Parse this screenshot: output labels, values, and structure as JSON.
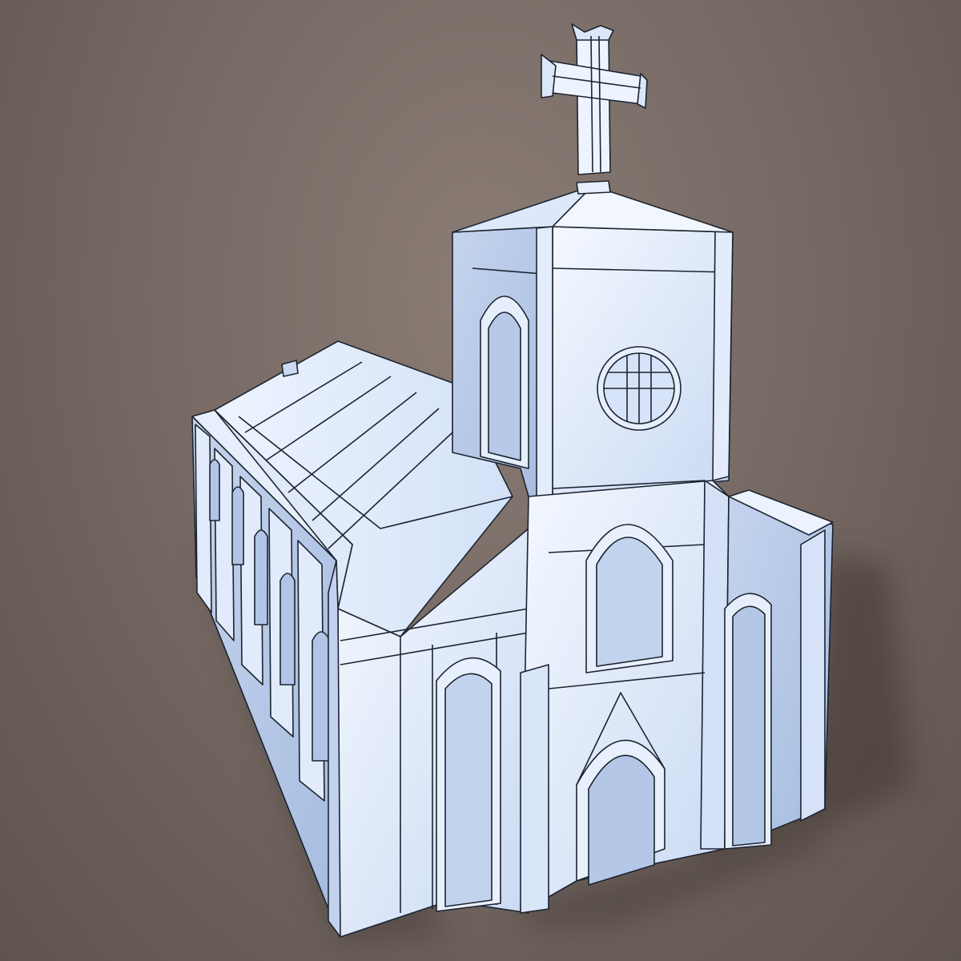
{
  "scene": {
    "background_color": "#7a6c66",
    "model_color": "#dbe7fa",
    "edge_color": "#1c2430",
    "shadow_color": "#4b403c",
    "parts": [
      "cross",
      "tower-roof",
      "bell-tower",
      "round-window",
      "nave-roof",
      "side-aisle",
      "front-facade",
      "main-door",
      "right-chapel"
    ]
  }
}
